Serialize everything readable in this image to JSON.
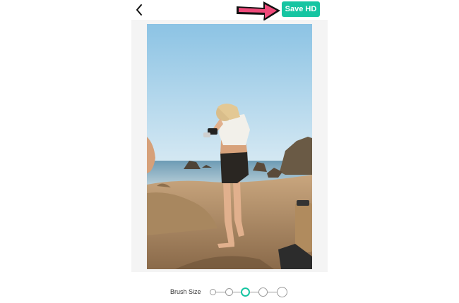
{
  "header": {
    "back_icon": "chevron-left-icon",
    "save_label": "Save HD",
    "save_color": "#16c5a2",
    "pointer_icon": "pink-arrow-icon",
    "pointer_color": "#ef4a7a"
  },
  "editor": {
    "image_subject": "photo"
  },
  "brush": {
    "label": "Brush Size",
    "sizes": [
      "xs",
      "s",
      "m",
      "l",
      "xl"
    ],
    "selected_index": 2
  }
}
